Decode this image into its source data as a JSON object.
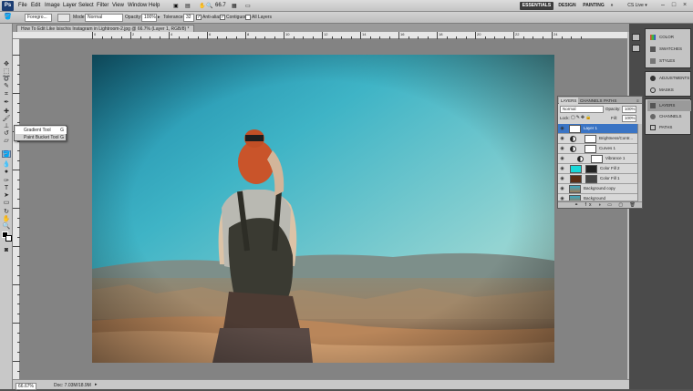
{
  "menubar": {
    "logo": "Ps",
    "items": [
      "File",
      "Edit",
      "Image",
      "Layer",
      "Select",
      "Filter",
      "View",
      "Window",
      "Help"
    ],
    "zoom": "66.7",
    "workspaces": [
      "ESSENTIALS",
      "DESIGN",
      "PAINTING"
    ],
    "more": "»",
    "cs_live": "CS Live ▾",
    "window_controls": [
      "–",
      "□",
      "×"
    ]
  },
  "options": {
    "preset": "Foregro...",
    "mode_label": "Mode:",
    "mode_value": "Normal",
    "opacity_label": "Opacity:",
    "opacity_value": "100%",
    "tolerance_label": "Tolerance:",
    "tolerance_value": "32",
    "anti_alias": "Anti-alias",
    "contiguous": "Contiguous",
    "all_layers": "All Layers"
  },
  "document": {
    "tab_title": "How To Edit Like Isischis Instagram in Lightroom-2.jpg @ 66.7% (Layer 1, RGB/8) *",
    "zoom_status": "66.67%",
    "doc_size": "Doc: 7.03M/18.9M"
  },
  "ruler": {
    "top_numbers": [
      "0",
      "2",
      "4",
      "6",
      "8",
      "10",
      "12",
      "14",
      "16",
      "18",
      "20",
      "22",
      "24"
    ]
  },
  "flyout": {
    "items": [
      "Gradient Tool",
      "Paint Bucket Tool"
    ],
    "shortcut": "G"
  },
  "layers_panel": {
    "tabs": [
      "LAYERS",
      "CHANNELS",
      "PATHS"
    ],
    "blend_mode": "Normal",
    "opacity_label": "Opacity:",
    "opacity_value": "100%",
    "lock_label": "Lock:",
    "fill_label": "Fill:",
    "fill_value": "100%",
    "layers": [
      {
        "name": "Layer 1",
        "selected": true
      },
      {
        "name": "Brightness/Contr...",
        "selected": false
      },
      {
        "name": "Curves 1",
        "selected": false
      },
      {
        "name": "Vibrance 1",
        "selected": false
      },
      {
        "name": "Color Fill 2",
        "selected": false
      },
      {
        "name": "Color Fill 1",
        "selected": false
      },
      {
        "name": "Background copy",
        "selected": false
      },
      {
        "name": "Background",
        "selected": false
      }
    ],
    "footer_icons": "⚭ fx ◑ ▭ ▢ 🗑"
  },
  "right_panels": {
    "group1": [
      "COLOR",
      "SWATCHES",
      "STYLES"
    ],
    "group2": [
      "ADJUSTMENTS",
      "MASKS"
    ],
    "group3": [
      "LAYERS",
      "CHANNELS",
      "PATHS"
    ]
  },
  "colors": {
    "accent_selected": "#3a74c4",
    "ui_bg": "#535353",
    "panel_bg": "#d2d2d2"
  }
}
